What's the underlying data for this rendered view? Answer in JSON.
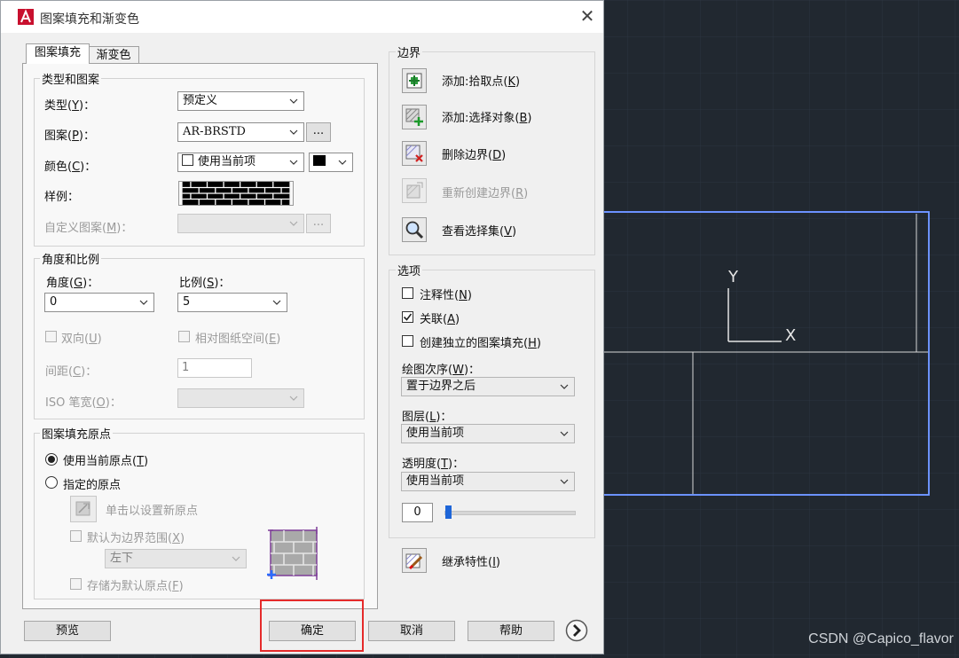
{
  "dialog": {
    "title": "图案填充和渐变色"
  },
  "tabs": [
    {
      "label": "图案填充",
      "active": true
    },
    {
      "label": "渐变色",
      "active": false
    }
  ],
  "type_pattern": {
    "group_title": "类型和图案",
    "type_label": "类型(",
    "type_key": "Y",
    "type_label_end": ")：",
    "type_value": "预定义",
    "pattern_label": "图案(",
    "pattern_key": "P",
    "pattern_label_end": ")：",
    "pattern_value": "AR-BRSTD",
    "browse_label": "...",
    "color_label": "颜色(",
    "color_key": "C",
    "color_label_end": ")：",
    "color_value": "使用当前项",
    "bg_color": "#000000",
    "sample_label": "样例：",
    "custom_label": "自定义图案(",
    "custom_key": "M",
    "custom_label_end": ")：",
    "custom_browse_label": "..."
  },
  "angle_scale": {
    "group_title": "角度和比例",
    "angle_label": "角度(",
    "angle_key": "G",
    "angle_label_end": ")：",
    "angle_value": "0",
    "scale_label": "比例(",
    "scale_key": "S",
    "scale_label_end": ")：",
    "scale_value": "5",
    "double_label": "双向(",
    "double_key": "U",
    "double_label_end": ")",
    "paper_label": "相对图纸空间(",
    "paper_key": "E",
    "paper_label_end": ")",
    "spacing_label": "间距(",
    "spacing_key": "C",
    "spacing_label_end": ")：",
    "spacing_value": "1",
    "iso_label": "ISO 笔宽(",
    "iso_key": "O",
    "iso_label_end": ")："
  },
  "origin": {
    "group_title": "图案填充原点",
    "current_label": "使用当前原点(",
    "current_key": "T",
    "current_label_end": ")",
    "specified_label": "指定的原点",
    "click_label": "单击以设置新原点",
    "default_extent_label": "默认为边界范围(",
    "default_extent_key": "X",
    "default_extent_label_end": ")",
    "position_value": "左下",
    "store_label": "存储为默认原点(",
    "store_key": "F",
    "store_label_end": ")"
  },
  "boundaries": {
    "group_title": "边界",
    "add_pick_label": "添加:拾取点(",
    "add_pick_key": "K",
    "add_pick_end": ")",
    "add_select_label": "添加:选择对象(",
    "add_select_key": "B",
    "add_select_end": ")",
    "remove_label": "删除边界(",
    "remove_key": "D",
    "remove_end": ")",
    "recreate_label": "重新创建边界(",
    "recreate_key": "R",
    "recreate_end": ")",
    "view_label": "查看选择集(",
    "view_key": "V",
    "view_end": ")"
  },
  "options": {
    "group_title": "选项",
    "annotative_label": "注释性(",
    "annotative_key": "N",
    "annotative_end": ")",
    "associative_label": "关联(",
    "associative_key": "A",
    "associative_end": ")",
    "separate_label": "创建独立的图案填充(",
    "separate_key": "H",
    "separate_end": ")",
    "draw_order_label": "绘图次序(",
    "draw_order_key": "W",
    "draw_order_end": ")：",
    "draw_order_value": "置于边界之后",
    "layer_label": "图层(",
    "layer_key": "L",
    "layer_end": ")：",
    "layer_value": "使用当前项",
    "transparency_label": "透明度(",
    "transparency_key": "T",
    "transparency_end": ")：",
    "transparency_value": "使用当前项",
    "transparency_number": "0",
    "transparency_level": 0
  },
  "inherit": {
    "label": "继承特性(",
    "key": "I",
    "end": ")"
  },
  "footer": {
    "preview_label": "预览",
    "ok_label": "确定",
    "cancel_label": "取消",
    "help_label": "帮助"
  },
  "canvas": {
    "y_axis_label": "Y",
    "x_axis_label": "X",
    "watermark": "CSDN @Capico_flavor"
  },
  "colors": {
    "accent_highlight": "#e52b2b",
    "selection_blue": "#4a7bff",
    "canvas_bg": "#212830"
  },
  "icons": {
    "app": "autocad-app-icon",
    "close": "close-icon",
    "more": "chevron-right-circle-icon"
  }
}
